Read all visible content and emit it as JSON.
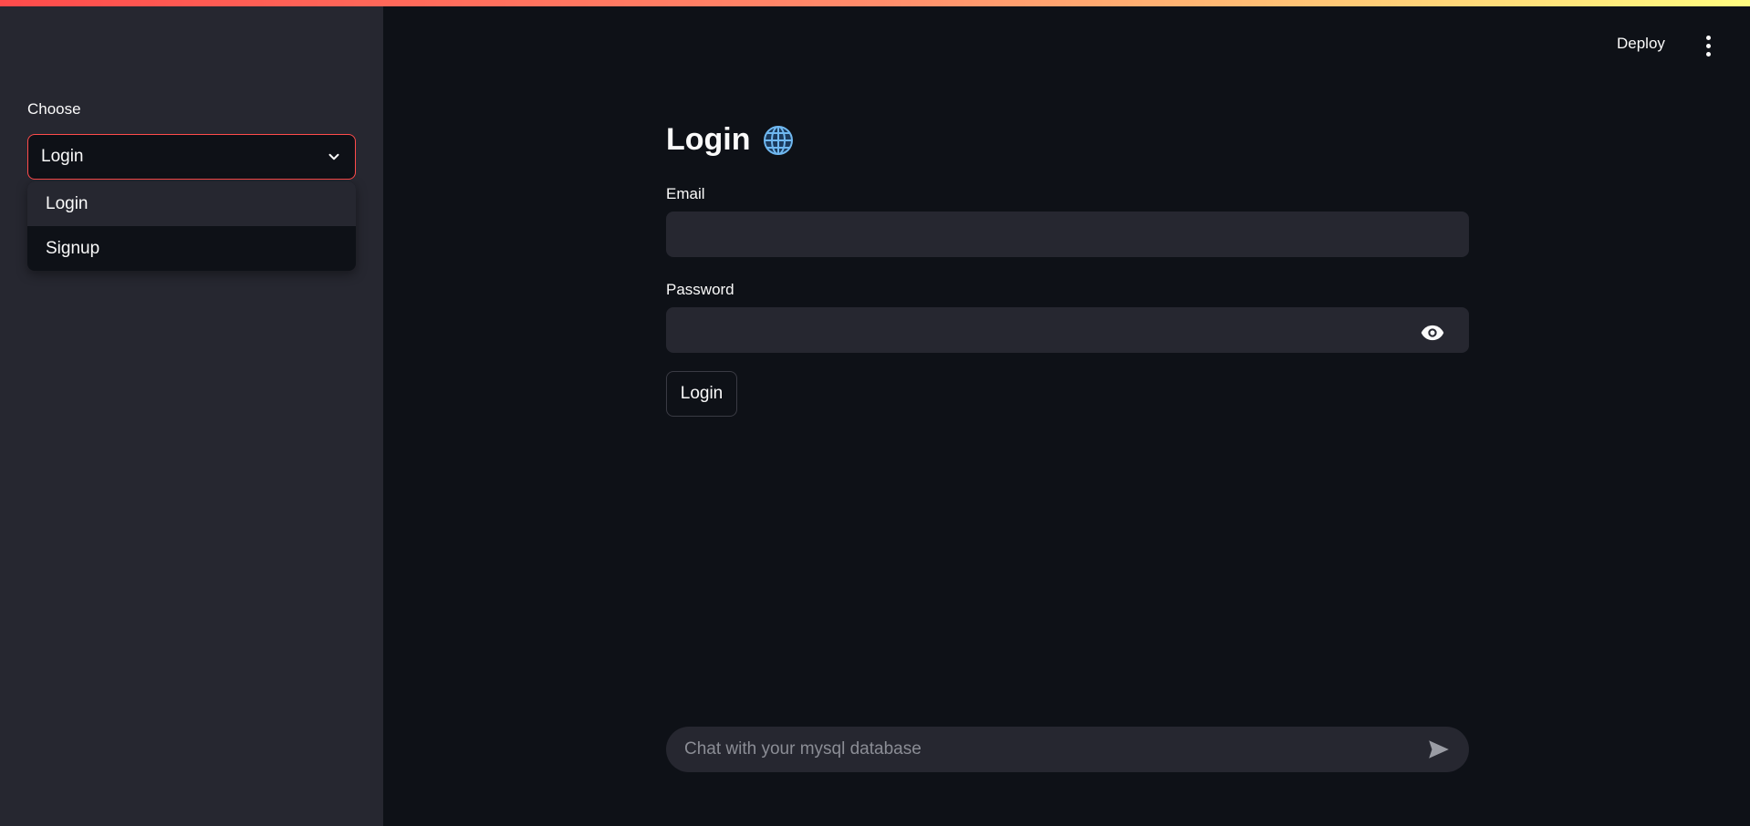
{
  "sidebar": {
    "select_label": "Choose",
    "selected_value": "Login",
    "options": [
      "Login",
      "Signup"
    ]
  },
  "header": {
    "deploy_label": "Deploy",
    "menu_icon": "more-vertical-icon"
  },
  "main": {
    "title": "Login",
    "title_icon": "globe-icon",
    "email_label": "Email",
    "email_value": "",
    "password_label": "Password",
    "password_value": "",
    "login_button": "Login"
  },
  "chat": {
    "placeholder": "Chat with your mysql database",
    "send_icon": "send-icon"
  },
  "colors": {
    "background": "#0e1117",
    "sidebar": "#262730",
    "accent": "#ff4b4b",
    "input_bg": "#262730",
    "text": "#fafafa"
  }
}
